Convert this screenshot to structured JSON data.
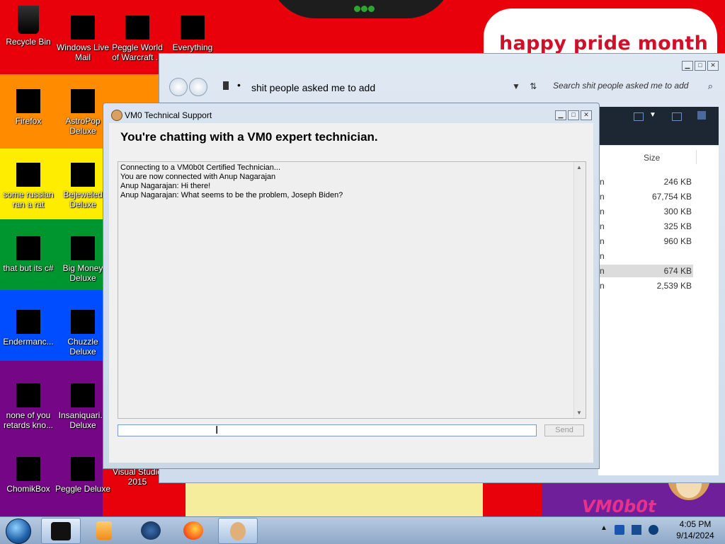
{
  "desktop": {
    "banner": "happy pride month",
    "logo_text": "VM0b0t",
    "stripe_colors": [
      "#e8000b",
      "#ff8c00",
      "#ffed00",
      "#00962f",
      "#004dff",
      "#750787"
    ],
    "icons": [
      {
        "label": "Recycle Bin",
        "icon": "recycle-bin-icon"
      },
      {
        "label": "Windows Live Mail",
        "icon": "mail-icon"
      },
      {
        "label": "Peggle World of Warcraft ...",
        "icon": "peggle-icon"
      },
      {
        "label": "Everything",
        "icon": "search-icon"
      },
      {
        "label": "Firefox",
        "icon": "firefox-icon"
      },
      {
        "label": "AstroPop Deluxe",
        "icon": "game-icon"
      },
      {
        "label": "some russian ran a rat",
        "icon": "app-icon"
      },
      {
        "label": "Bejeweled Deluxe",
        "icon": "gem-icon"
      },
      {
        "label": "that but its c#",
        "icon": "app-icon"
      },
      {
        "label": "Big Money Deluxe",
        "icon": "money-icon"
      },
      {
        "label": "Endermanc...",
        "icon": "app-icon"
      },
      {
        "label": "Chuzzle Deluxe",
        "icon": "game-icon"
      },
      {
        "label": "none of you retards kno...",
        "icon": "app-icon"
      },
      {
        "label": "Insaniquari... Deluxe",
        "icon": "game-icon"
      },
      {
        "label": "ChomikBox",
        "icon": "chomikbox-icon"
      },
      {
        "label": "Peggle Deluxe",
        "icon": "peggle-icon"
      },
      {
        "label": "Visual Studio 2015",
        "icon": "visual-studio-icon"
      }
    ]
  },
  "explorer": {
    "address": "shit people asked me to add",
    "search_placeholder": "Search shit people asked me to add",
    "size_header": "Size",
    "name_fragment": "n",
    "sizes": [
      "246 KB",
      "67,754 KB",
      "300 KB",
      "325 KB",
      "960 KB",
      "674 KB",
      "2,539 KB"
    ],
    "selected_index": 5
  },
  "chat": {
    "window_title": "VM0 Technical Support",
    "heading": "You're chatting with a VM0 expert technician.",
    "messages": [
      "Connecting to a VM0b0t Certified Technician...",
      "You are now connected with Anup Nagarajan",
      "Anup Nagarajan: Hi there!",
      "Anup Nagarajan: What seems to be the problem, Joseph Biden?"
    ],
    "input_value": "",
    "send_label": "Send"
  },
  "taskbar": {
    "pinned": [
      "start-button",
      "terminal-icon",
      "media-player-icon",
      "globe-icon",
      "firefox-icon",
      "support-chat-icon"
    ],
    "clock_time": "4:05 PM",
    "clock_date": "9/14/2024"
  }
}
